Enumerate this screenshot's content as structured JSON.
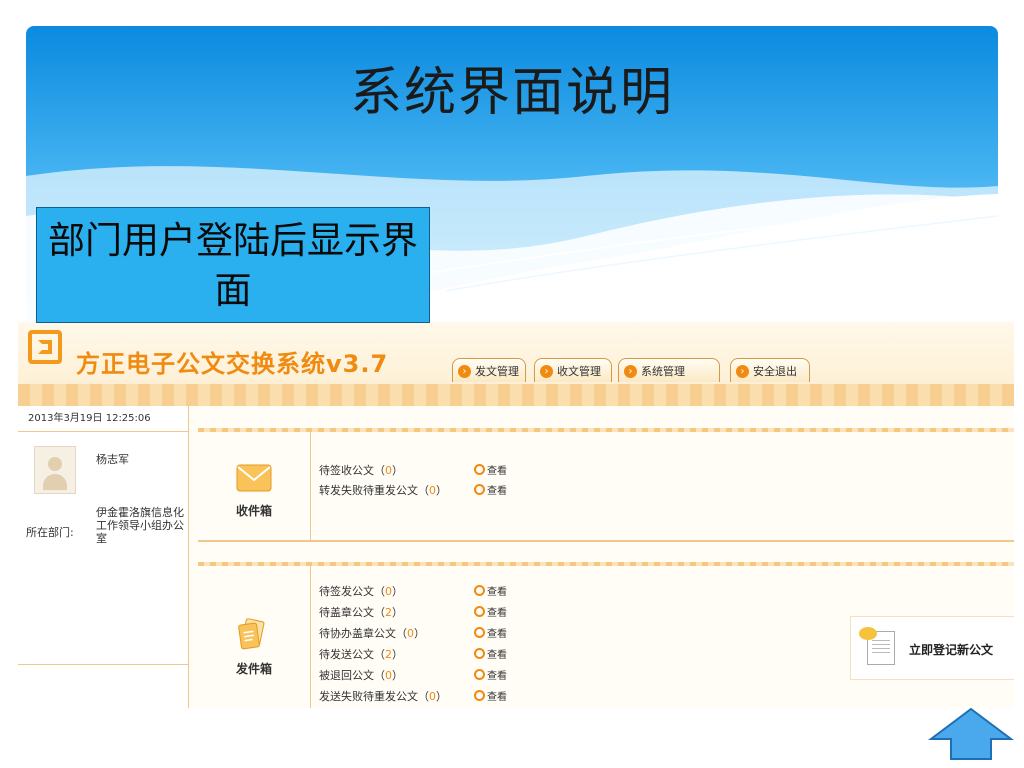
{
  "slide": {
    "title": "系统界面说明",
    "callout": "部门用户登陆后显示界面"
  },
  "app": {
    "title": "方正电子公文交换系统v3.7",
    "nav": [
      {
        "label": "发文管理"
      },
      {
        "label": "收文管理"
      },
      {
        "label": "系统管理"
      },
      {
        "label": "安全退出"
      }
    ]
  },
  "sidebar": {
    "datetime": "2013年3月19日 12:25:06",
    "user_name": "杨志军",
    "dept_label": "所在部门:",
    "dept_value": "伊金霍洛旗信息化工作领导小组办公室"
  },
  "inbox": {
    "label": "收件箱",
    "items": [
      {
        "text": "待签收公文（",
        "count": "0",
        "close": "）",
        "view": "查看"
      },
      {
        "text": "转发失败待重发公文（",
        "count": "0",
        "close": "）",
        "view": "查看"
      }
    ]
  },
  "outbox": {
    "label": "发件箱",
    "items": [
      {
        "text": "待签发公文（",
        "count": "0",
        "close": "）",
        "view": "查看"
      },
      {
        "text": "待盖章公文（",
        "count": "2",
        "close": "）",
        "view": "查看"
      },
      {
        "text": "待协办盖章公文（",
        "count": "0",
        "close": "）",
        "view": "查看"
      },
      {
        "text": "待发送公文（",
        "count": "2",
        "close": "）",
        "view": "查看"
      },
      {
        "text": "被退回公文（",
        "count": "0",
        "close": "）",
        "view": "查看"
      },
      {
        "text": "发送失败待重发公文（",
        "count": "0",
        "close": "）",
        "view": "查看"
      }
    ]
  },
  "register": {
    "label": "立即登记新公文"
  },
  "colors": {
    "accent": "#f08a10",
    "callout_bg": "#2ab0ee",
    "header_blue": "#0f8fe0"
  },
  "icons": [
    "logo-icon",
    "envelope-icon",
    "documents-icon",
    "new-document-icon",
    "magnifier-icon",
    "up-arrow-icon"
  ]
}
